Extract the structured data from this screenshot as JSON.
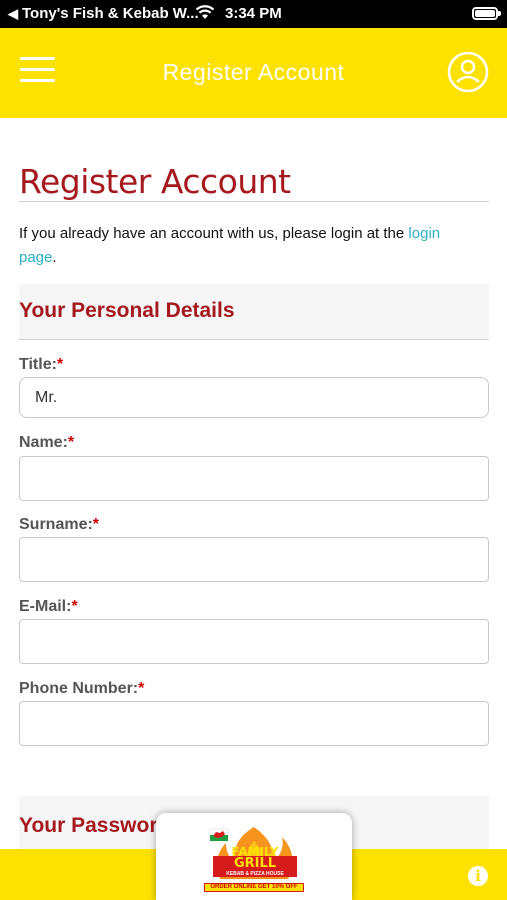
{
  "status_bar": {
    "back_app": "Tony's Fish & Kebab W...",
    "time": "3:34 PM"
  },
  "app_bar": {
    "title": "Register Account"
  },
  "page": {
    "heading": "Register Account",
    "intro_text": "If you already have an account with us, please login at the ",
    "login_link": "login page",
    "intro_end": "."
  },
  "personal_details": {
    "section_title": "Your Personal Details",
    "title_label": "Title:",
    "title_value": "Mr.",
    "name_label": "Name:",
    "surname_label": "Surname:",
    "email_label": "E-Mail:",
    "phone_label": "Phone Number:",
    "required_marker": "*"
  },
  "password": {
    "section_title": "Your Password"
  },
  "ad_banner": {
    "brand_line1": "FAMILY",
    "brand_line2": "GRILL",
    "tagline": "KEBAB & PIZZA HOUSE",
    "promo": "ORDER ONLINE GET 10% OFF"
  },
  "footer": {
    "info_icon": "i"
  },
  "colors": {
    "brand_yellow": "#fde100",
    "heading_red": "#a5191e",
    "link_teal": "#2bb0c3",
    "required_red": "#d20000"
  }
}
